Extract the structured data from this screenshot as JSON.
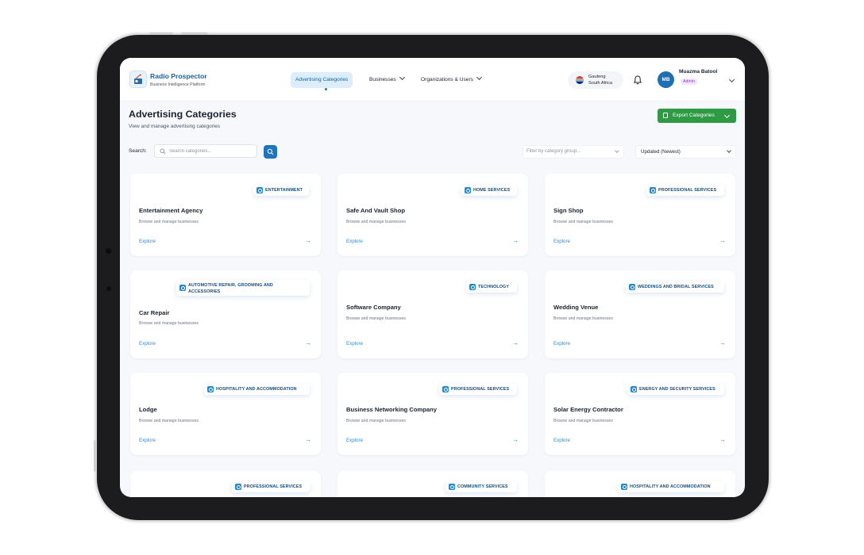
{
  "header": {
    "brand_name": "Radio Prospector",
    "brand_tagline": "Business Intelligence Platform",
    "nav": [
      {
        "label": "Advertising Categories"
      },
      {
        "label": "Businesses"
      },
      {
        "label": "Organizations & Users"
      }
    ],
    "location": {
      "region": "Gauteng",
      "country": "South Africa"
    },
    "user": {
      "initials": "MB",
      "name": "Muazma Batool",
      "role": "Admin"
    }
  },
  "page": {
    "title": "Advertising Categories",
    "subtitle": "View and manage advertising categories",
    "export_label": "Export Categories",
    "search_label": "Search:",
    "search_placeholder": "Search categories...",
    "filter_placeholder": "Filter by category group...",
    "sort_value": "Updated (Newest)"
  },
  "cards": [
    {
      "badge": "ENTERTAINMENT",
      "title": "Entertainment Agency",
      "desc": "Browse and manage businesses",
      "link": "Explore"
    },
    {
      "badge": "HOME SERVICES",
      "title": "Safe And Vault Shop",
      "desc": "Browse and manage businesses",
      "link": "Explore"
    },
    {
      "badge": "PROFESSIONAL SERVICES",
      "title": "Sign Shop",
      "desc": "Browse and manage businesses",
      "link": "Explore"
    },
    {
      "badge": "AUTOMOTIVE REPAIR, GROOMING AND ACCESSORIES",
      "title": "Car Repair",
      "desc": "Browse and manage businesses",
      "link": "Explore"
    },
    {
      "badge": "TECHNOLOGY",
      "title": "Software Company",
      "desc": "Browse and manage businesses",
      "link": "Explore"
    },
    {
      "badge": "WEDDINGS AND BRIDAL SERVICES",
      "title": "Wedding Venue",
      "desc": "Browse and manage businesses",
      "link": "Explore"
    },
    {
      "badge": "HOSPITALITY AND ACCOMMODATION",
      "title": "Lodge",
      "desc": "Browse and manage businesses",
      "link": "Explore"
    },
    {
      "badge": "PROFESSIONAL SERVICES",
      "title": "Business Networking Company",
      "desc": "Browse and manage businesses",
      "link": "Explore"
    },
    {
      "badge": "ENERGY AND SECURITY SERVICES",
      "title": "Solar Energy Contractor",
      "desc": "Browse and manage businesses",
      "link": "Explore"
    },
    {
      "badge": "PROFESSIONAL SERVICES"
    },
    {
      "badge": "COMMUNITY SERVICES"
    },
    {
      "badge": "HOSPITALITY AND ACCOMMODATION"
    }
  ],
  "colors": {
    "accent": "#1f74bf",
    "export": "#2f9a44",
    "badge_icon": "#1f8ad4",
    "link": "#2b8fd8"
  }
}
